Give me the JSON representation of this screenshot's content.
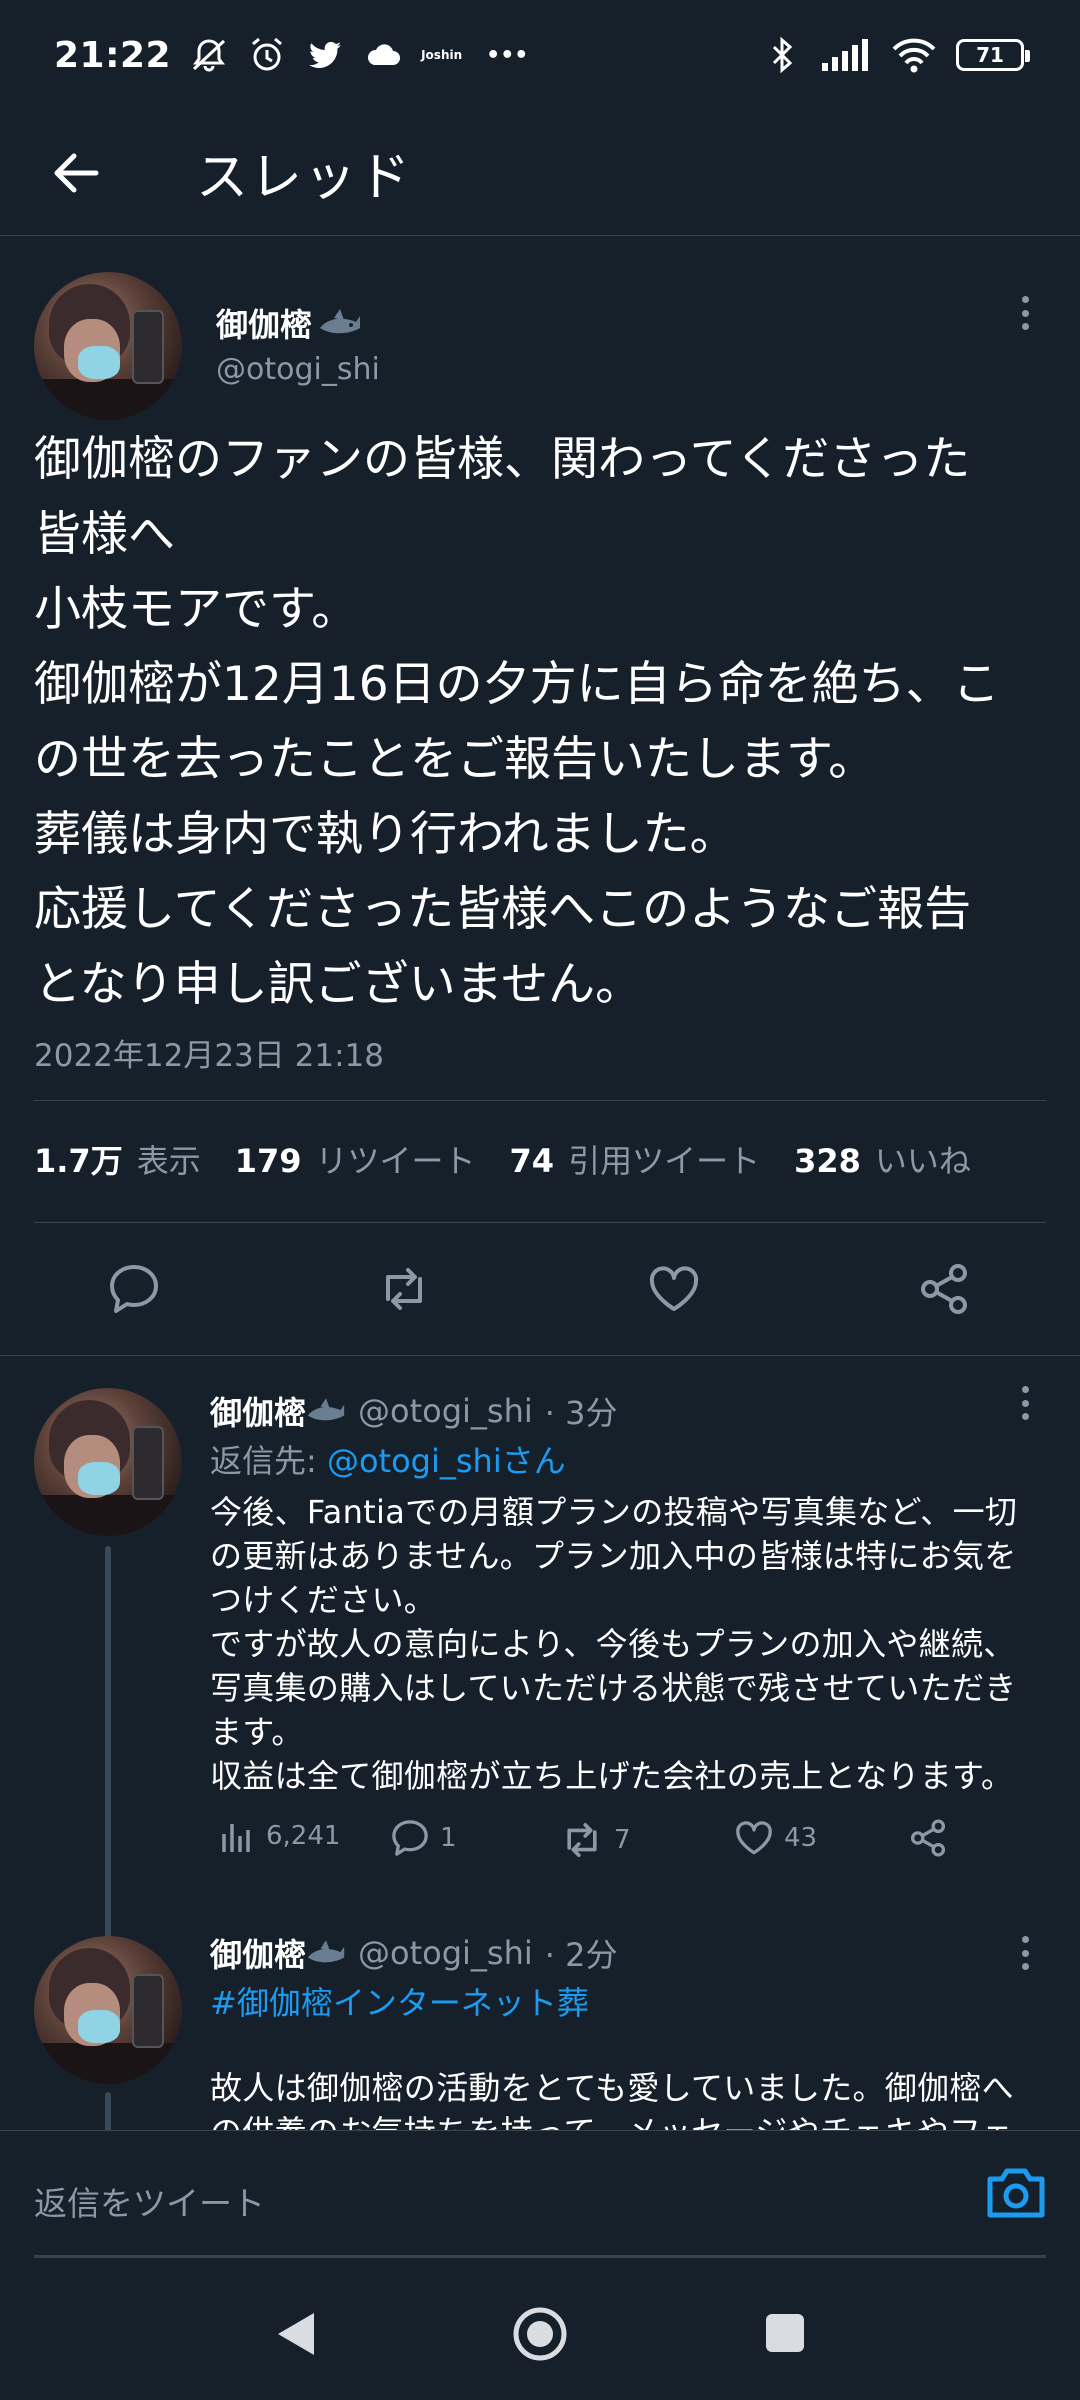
{
  "status_bar": {
    "time": "21:22",
    "notification_app_label": "Joshin",
    "overflow": "•••",
    "battery": "71"
  },
  "header": {
    "title": "スレッド"
  },
  "main_tweet": {
    "display_name": "御伽樒",
    "handle": "@otogi_shi",
    "text": "御伽樒のファンの皆様、関わってくださった\n皆様へ\n小枝モアです。\n御伽樒が12月16日の夕方に自ら命を絶ち、こ\nの世を去ったことをご報告いたします。\n葬儀は身内で執り行われました。\n応援してくださった皆様へこのようなご報告\nとなり申し訳ございません。",
    "timestamp": "2022年12月23日 21:18",
    "stats": {
      "views_count": "1.7万",
      "views_label": "表示",
      "retweets_count": "179",
      "retweets_label": "リツイート",
      "quotes_count": "74",
      "quotes_label": "引用ツイート",
      "likes_count": "328",
      "likes_label": "いいね"
    }
  },
  "replies": [
    {
      "display_name": "御伽樒",
      "handle": "@otogi_shi",
      "time": "· 3分",
      "reply_to_prefix": "返信先: ",
      "reply_to_handle": "@otogi_shiさん",
      "text": "今後、Fantiaでの月額プランの投稿や写真集など、一切\nの更新はありません。プラン加入中の皆様は特にお気を\nつけください。\nですが故人の意向により、今後もプランの加入や継続、\n写真集の購入はしていただける状態で残させていただき\nます。\n収益は全て御伽樒が立ち上げた会社の売上となります。",
      "views": "6,241",
      "replies": "1",
      "retweets": "7",
      "likes": "43"
    },
    {
      "display_name": "御伽樒",
      "handle": "@otogi_shi",
      "time": "· 2分",
      "hashtag": "#御伽樒インターネット葬",
      "text": "故人は御伽樒の活動をとても愛していました。御伽樒へ\nの供養のお気持ちを持って、メッセージやチェキやフェ"
    }
  ],
  "composer": {
    "placeholder": "返信をツイート"
  },
  "colors": {
    "background": "#15202b",
    "accent": "#1d9bf0",
    "muted": "#8b98a5",
    "divider": "#38444d"
  }
}
